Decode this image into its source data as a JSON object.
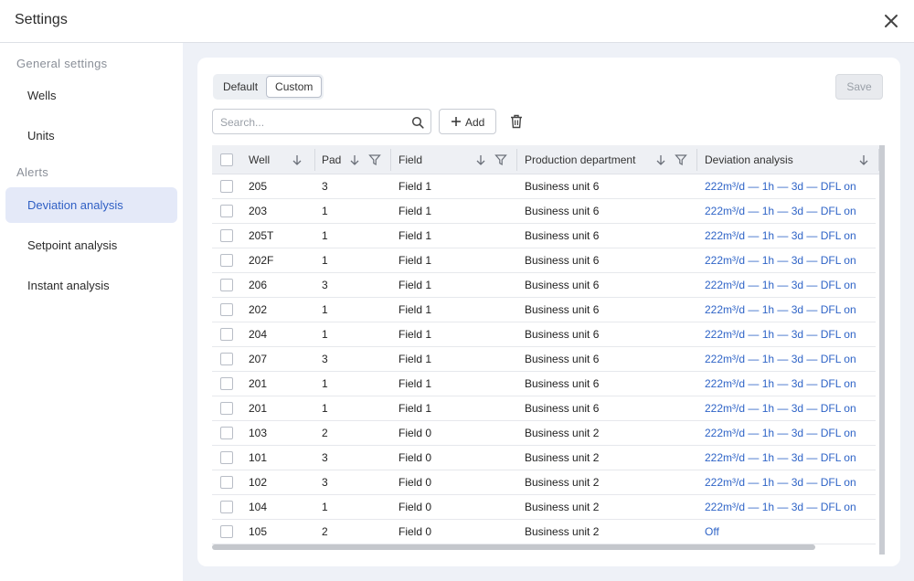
{
  "header": {
    "title": "Settings"
  },
  "sidebar": {
    "groups": [
      {
        "label": "General settings"
      },
      {
        "label": "Alerts"
      }
    ],
    "items": [
      {
        "label": "Wells"
      },
      {
        "label": "Units"
      },
      {
        "label": "Deviation analysis",
        "active": true
      },
      {
        "label": "Setpoint analysis"
      },
      {
        "label": "Instant analysis"
      }
    ]
  },
  "toolbar": {
    "segments": [
      {
        "label": "Default"
      },
      {
        "label": "Custom",
        "active": true
      }
    ],
    "save_label": "Save",
    "search_placeholder": "Search...",
    "add_label": "Add"
  },
  "table": {
    "columns": [
      {
        "label": "Well"
      },
      {
        "label": "Pad"
      },
      {
        "label": "Field"
      },
      {
        "label": "Production department"
      },
      {
        "label": "Deviation analysis"
      }
    ],
    "rows": [
      {
        "well": "205",
        "pad": "3",
        "field": "Field 1",
        "dept": "Business unit 6",
        "dev": "222m³/d — 1h — 3d — DFL on"
      },
      {
        "well": "203",
        "pad": "1",
        "field": "Field 1",
        "dept": "Business unit 6",
        "dev": "222m³/d — 1h — 3d — DFL on"
      },
      {
        "well": "205T",
        "pad": "1",
        "field": "Field 1",
        "dept": "Business unit 6",
        "dev": "222m³/d — 1h — 3d — DFL on"
      },
      {
        "well": "202F",
        "pad": "1",
        "field": "Field 1",
        "dept": "Business unit 6",
        "dev": "222m³/d — 1h — 3d — DFL on"
      },
      {
        "well": "206",
        "pad": "3",
        "field": "Field 1",
        "dept": "Business unit 6",
        "dev": "222m³/d — 1h — 3d — DFL on"
      },
      {
        "well": "202",
        "pad": "1",
        "field": "Field 1",
        "dept": "Business unit 6",
        "dev": "222m³/d — 1h — 3d — DFL on"
      },
      {
        "well": "204",
        "pad": "1",
        "field": "Field 1",
        "dept": "Business unit 6",
        "dev": "222m³/d — 1h — 3d — DFL on"
      },
      {
        "well": "207",
        "pad": "3",
        "field": "Field 1",
        "dept": "Business unit 6",
        "dev": "222m³/d — 1h — 3d — DFL on"
      },
      {
        "well": "201",
        "pad": "1",
        "field": "Field 1",
        "dept": "Business unit 6",
        "dev": "222m³/d — 1h — 3d — DFL on"
      },
      {
        "well": "201",
        "pad": "1",
        "field": "Field 1",
        "dept": "Business unit 6",
        "dev": "222m³/d — 1h — 3d — DFL on"
      },
      {
        "well": "103",
        "pad": "2",
        "field": "Field 0",
        "dept": "Business unit 2",
        "dev": "222m³/d — 1h — 3d — DFL on"
      },
      {
        "well": "101",
        "pad": "3",
        "field": "Field 0",
        "dept": "Business unit 2",
        "dev": "222m³/d — 1h — 3d — DFL on"
      },
      {
        "well": "102",
        "pad": "3",
        "field": "Field 0",
        "dept": "Business unit 2",
        "dev": "222m³/d — 1h — 3d — DFL on"
      },
      {
        "well": "104",
        "pad": "1",
        "field": "Field 0",
        "dept": "Business unit 2",
        "dev": "222m³/d — 1h — 3d — DFL on"
      },
      {
        "well": "105",
        "pad": "2",
        "field": "Field 0",
        "dept": "Business unit 2",
        "dev": "Off"
      }
    ]
  },
  "colors": {
    "accent": "#2f64c7",
    "active_bg": "#e4e9f8",
    "page_bg": "#eef1f7"
  }
}
